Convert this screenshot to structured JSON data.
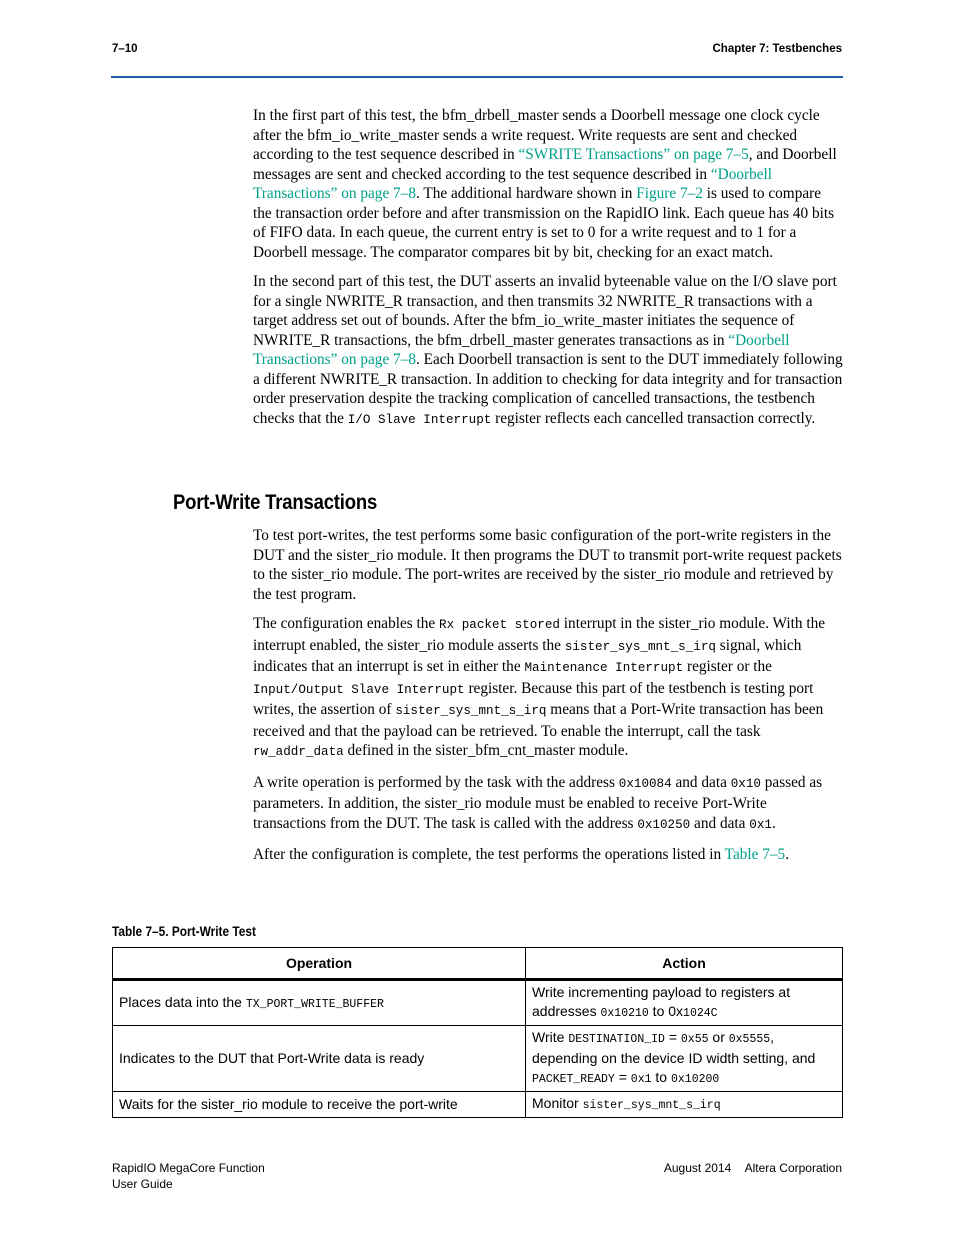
{
  "header": {
    "page_number": "7–10",
    "chapter": "Chapter 7:  Testbenches"
  },
  "colors": {
    "link": "#00a08a",
    "rule": "#1f5fa0"
  },
  "intro_paragraphs": [
    [
      {
        "t": "In the first part of this test, the bfm_drbell_master sends a Doorbell message one clock cycle after the bfm_io_write_master sends a write request. Write requests are sent and checked according to the test sequence described in ",
        "s": "text"
      },
      {
        "t": "“SWRITE Transactions” on page 7–5",
        "s": "link"
      },
      {
        "t": ", and Doorbell messages are sent and checked according to the test sequence described in ",
        "s": "text"
      },
      {
        "t": "“Doorbell Transactions” on page 7–8",
        "s": "link"
      },
      {
        "t": ". The additional hardware shown in ",
        "s": "text"
      },
      {
        "t": "Figure 7–2",
        "s": "link"
      },
      {
        "t": " is used to compare the transaction order before and after transmission on the RapidIO link. Each queue has 40 bits of FIFO data. In each queue, the current entry is set to 0 for a write request and to 1 for a Doorbell message. The comparator compares bit by bit, checking for an exact match.",
        "s": "text"
      }
    ],
    [
      {
        "t": "In the second part of this test, the DUT asserts an invalid byteenable value on the I/O slave port for a single NWRITE_R transaction, and then transmits 32 NWRITE_R transactions with a target address set out of bounds. After the bfm_io_write_master initiates the sequence of NWRITE_R transactions, the bfm_drbell_master generates transactions as in ",
        "s": "text"
      },
      {
        "t": "“Doorbell Transactions” on page 7–8",
        "s": "link"
      },
      {
        "t": ". Each Doorbell transaction is sent to the DUT immediately following a different NWRITE_R transaction. In addition to checking for data integrity and for transaction order preservation despite the tracking complication of cancelled transactions, the testbench checks that the ",
        "s": "text"
      },
      {
        "t": "I/O Slave Interrupt",
        "s": "code"
      },
      {
        "t": " register reflects each cancelled transaction correctly.",
        "s": "text"
      }
    ]
  ],
  "section_title": "Port-Write Transactions",
  "section_paragraphs": [
    [
      {
        "t": "To test port-writes, the test performs some basic configuration of the port-write registers in the DUT and the sister_rio module. It then programs the DUT to transmit port-write request packets to the sister_rio module. The port-writes are received by the sister_rio module and retrieved by the test program.",
        "s": "text"
      }
    ],
    [
      {
        "t": "The configuration enables the ",
        "s": "text"
      },
      {
        "t": "Rx packet stored",
        "s": "code"
      },
      {
        "t": " interrupt in the sister_rio module. With the interrupt enabled, the sister_rio module asserts the ",
        "s": "text"
      },
      {
        "t": "sister_sys_mnt_s_irq",
        "s": "code"
      },
      {
        "t": " signal, which indicates that an interrupt is set in either the ",
        "s": "text"
      },
      {
        "t": "Maintenance Interrupt",
        "s": "code"
      },
      {
        "t": " register or the ",
        "s": "text"
      },
      {
        "t": "Input/Output Slave Interrupt",
        "s": "code"
      },
      {
        "t": " register. Because this part of the testbench is testing port writes, the assertion of ",
        "s": "text"
      },
      {
        "t": "sister_sys_mnt_s_irq",
        "s": "code"
      },
      {
        "t": " means that a Port-Write transaction has been received and that the payload can be retrieved. To enable the interrupt, call the task ",
        "s": "text"
      },
      {
        "t": "rw_addr_data",
        "s": "code"
      },
      {
        "t": " defined in the sister_bfm_cnt_master module.",
        "s": "text"
      }
    ],
    [
      {
        "t": "A write operation is performed by the task with the address ",
        "s": "text"
      },
      {
        "t": "0x10084",
        "s": "code"
      },
      {
        "t": " and data ",
        "s": "text"
      },
      {
        "t": "0x10",
        "s": "code"
      },
      {
        "t": " passed as parameters. In addition, the sister_rio module must be enabled to receive Port-Write transactions from the DUT. The task is called with the address ",
        "s": "text"
      },
      {
        "t": "0x10250",
        "s": "code"
      },
      {
        "t": " and data ",
        "s": "text"
      },
      {
        "t": "0x1",
        "s": "code"
      },
      {
        "t": ".",
        "s": "text"
      }
    ],
    [
      {
        "t": "After the configuration is complete, the test performs the operations listed in ",
        "s": "text"
      },
      {
        "t": "Table 7–5",
        "s": "link"
      },
      {
        "t": ".",
        "s": "text"
      }
    ]
  ],
  "table": {
    "caption": "Table 7–5.  Port-Write Test",
    "headers": [
      "Operation",
      "Action"
    ],
    "rows": [
      [
        [
          {
            "t": "Places data into the ",
            "s": "text"
          },
          {
            "t": "TX_PORT_WRITE_BUFFER",
            "s": "code"
          }
        ],
        [
          {
            "t": "Write incrementing payload to registers at addresses ",
            "s": "text"
          },
          {
            "t": "0x10210",
            "s": "code"
          },
          {
            "t": " to 0x",
            "s": "text"
          },
          {
            "t": "1024C",
            "s": "code"
          }
        ]
      ],
      [
        [
          {
            "t": "Indicates to the DUT that Port-Write data is ready",
            "s": "text"
          }
        ],
        [
          {
            "t": "Write ",
            "s": "text"
          },
          {
            "t": "DESTINATION_ID",
            "s": "code"
          },
          {
            "t": " = ",
            "s": "text"
          },
          {
            "t": "0x55",
            "s": "code"
          },
          {
            "t": " or ",
            "s": "text"
          },
          {
            "t": "0x5555",
            "s": "code"
          },
          {
            "t": ", depending on the device ID width setting, and ",
            "s": "text"
          },
          {
            "t": "PACKET_READY",
            "s": "code"
          },
          {
            "t": " = ",
            "s": "text"
          },
          {
            "t": "0x1",
            "s": "code"
          },
          {
            "t": " to ",
            "s": "text"
          },
          {
            "t": "0x10200",
            "s": "code"
          }
        ]
      ],
      [
        [
          {
            "t": "Waits for the sister_rio module to receive the port-write",
            "s": "text"
          }
        ],
        [
          {
            "t": "Monitor ",
            "s": "text"
          },
          {
            "t": "sister_sys_mnt_s_irq",
            "s": "code"
          }
        ]
      ]
    ]
  },
  "footer": {
    "product": "RapidIO MegaCore Function",
    "doc": "User Guide",
    "date": "August 2014",
    "company": "Altera Corporation"
  }
}
